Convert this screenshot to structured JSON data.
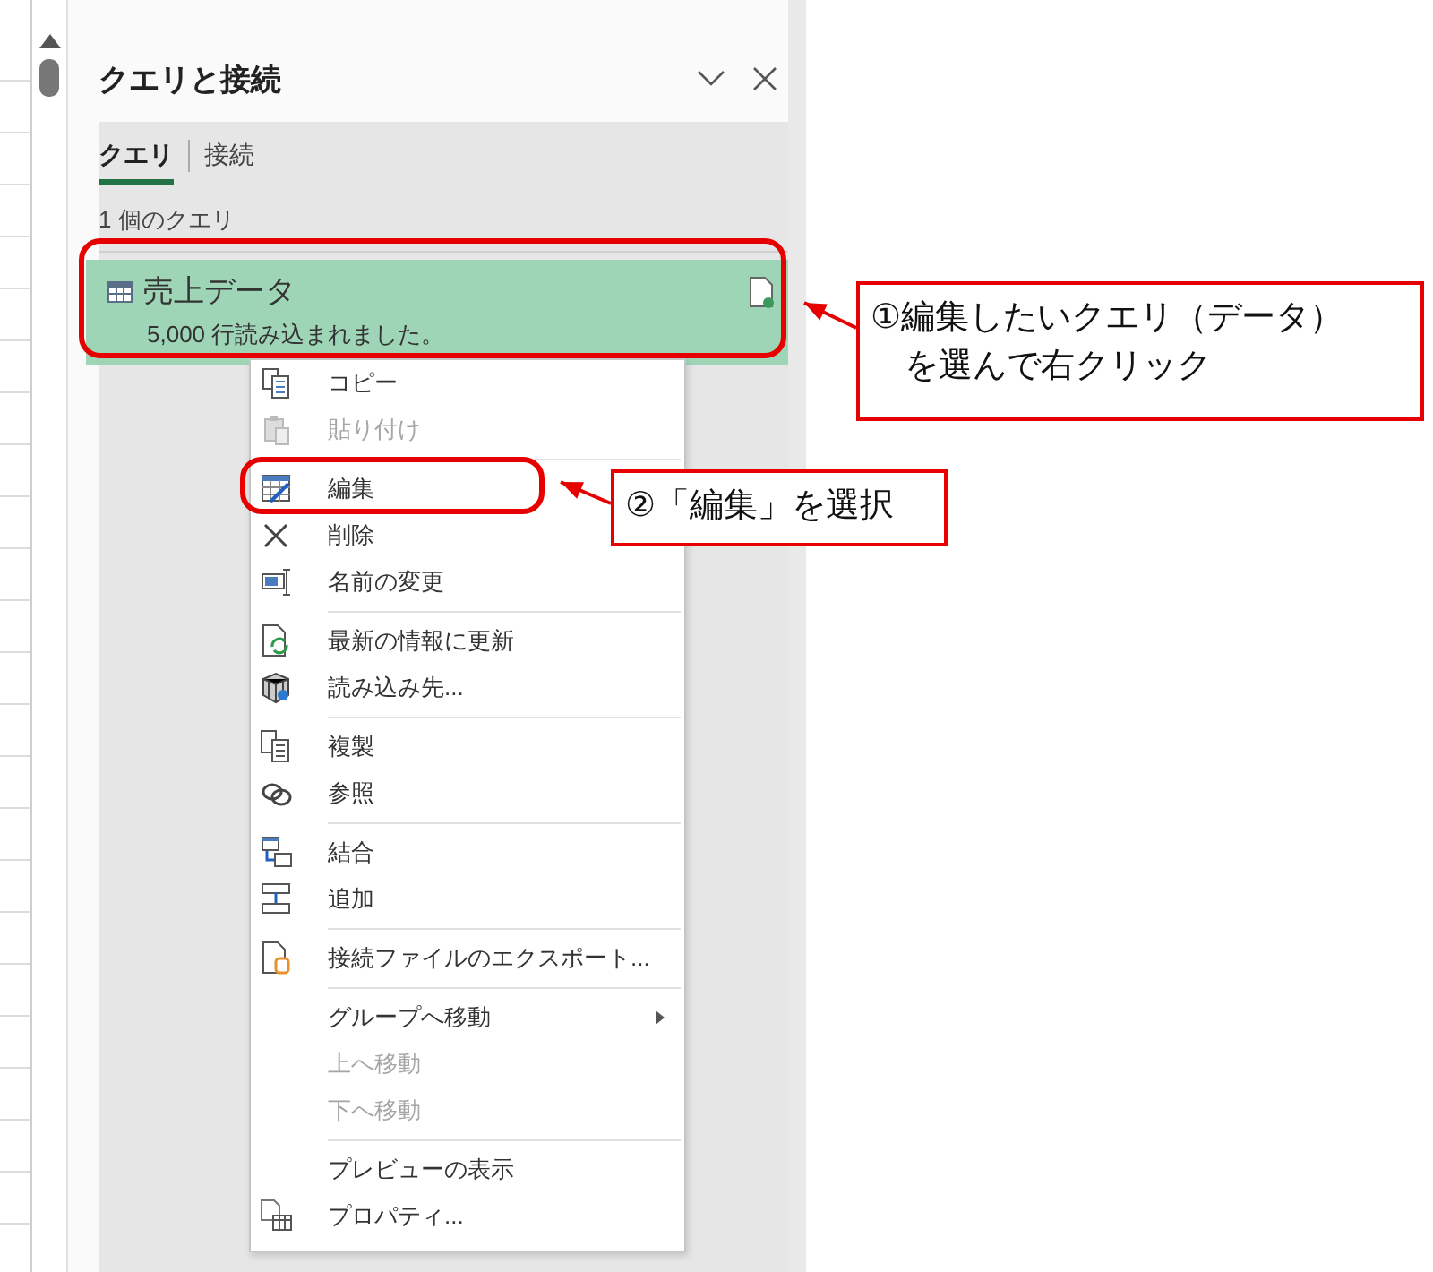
{
  "panel": {
    "title": "クエリと接続",
    "tabs": [
      {
        "label": "クエリ",
        "selected": true
      },
      {
        "label": "接続",
        "selected": false
      }
    ],
    "count": "1 個のクエリ",
    "queries": [
      {
        "name": "売上データ",
        "status": "5,000 行読み込まれました。",
        "selected": true
      }
    ]
  },
  "context_menu": {
    "groups": [
      [
        {
          "label": "コピー",
          "disabled": false,
          "submenu": false
        },
        {
          "label": "貼り付け",
          "disabled": true,
          "submenu": false
        }
      ],
      [
        {
          "label": "編集",
          "disabled": false,
          "submenu": false
        },
        {
          "label": "削除",
          "disabled": false,
          "submenu": false
        },
        {
          "label": "名前の変更",
          "disabled": false,
          "submenu": false
        }
      ],
      [
        {
          "label": "最新の情報に更新",
          "disabled": false,
          "submenu": false
        },
        {
          "label": "読み込み先...",
          "disabled": false,
          "submenu": false
        }
      ],
      [
        {
          "label": "複製",
          "disabled": false,
          "submenu": false
        },
        {
          "label": "参照",
          "disabled": false,
          "submenu": false
        }
      ],
      [
        {
          "label": "結合",
          "disabled": false,
          "submenu": false
        },
        {
          "label": "追加",
          "disabled": false,
          "submenu": false
        }
      ],
      [
        {
          "label": "接続ファイルのエクスポート...",
          "disabled": false,
          "submenu": false
        }
      ],
      [
        {
          "label": "グループへ移動",
          "disabled": false,
          "submenu": true
        },
        {
          "label": "上へ移動",
          "disabled": true,
          "submenu": false
        },
        {
          "label": "下へ移動",
          "disabled": true,
          "submenu": false
        }
      ],
      [
        {
          "label": "プレビューの表示",
          "disabled": false,
          "submenu": false
        },
        {
          "label": "プロパティ...",
          "disabled": false,
          "submenu": false
        }
      ]
    ]
  },
  "annotations": [
    {
      "lines": [
        "①編集したいクエリ（データ）",
        "を選んで右クリック"
      ]
    },
    {
      "lines": [
        "②「編集」を選択"
      ]
    }
  ]
}
